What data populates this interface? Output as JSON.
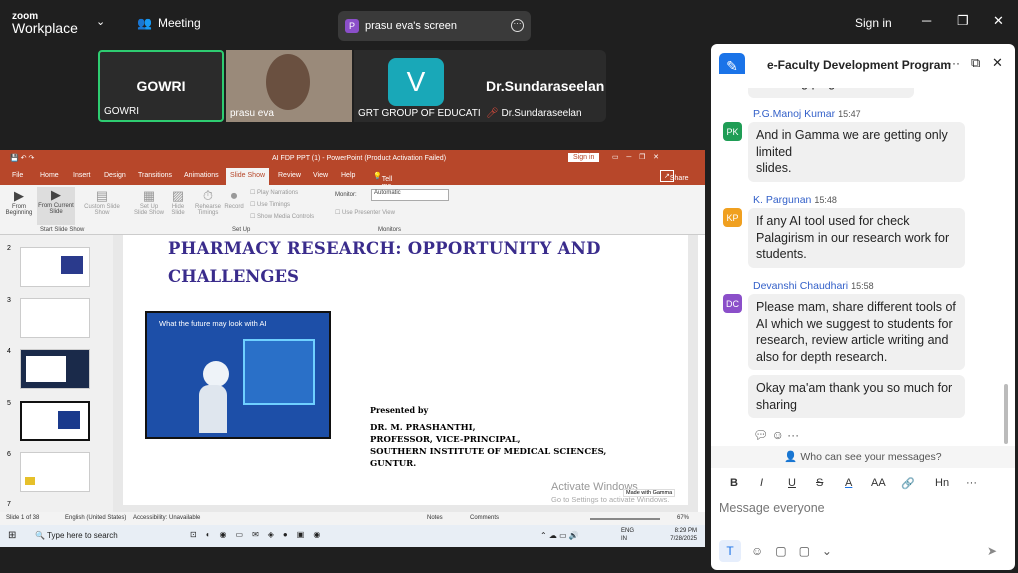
{
  "zoom": {
    "logo_top": "zoom",
    "logo_bottom": "Workplace",
    "meeting": "Meeting",
    "share_tag": "P",
    "share_label": "prasu eva's screen",
    "signin": "Sign in"
  },
  "tiles": [
    {
      "name": "GOWRI",
      "label": "GOWRI"
    },
    {
      "label": "prasu eva"
    },
    {
      "letter": "V",
      "label": "GRT GROUP OF EDUCATI..."
    },
    {
      "name": "Dr.Sundaraseelan",
      "label": "Dr.Sundaraseelan"
    }
  ],
  "ppt": {
    "title": "AI FDP PPT (1) - PowerPoint (Product Activation Failed)",
    "signin": "Sign in",
    "share": "Share",
    "menu": [
      "File",
      "Home",
      "Insert",
      "Design",
      "Transitions",
      "Animations",
      "Slide Show",
      "Review",
      "View",
      "Help",
      "Tell me what you want to do"
    ],
    "ribbon": {
      "from_beginning": "From Beginning",
      "from_current": "From Current Slide",
      "custom": "Custom Slide Show",
      "group_start": "Start Slide Show",
      "setup": "Set Up Slide Show",
      "hide": "Hide Slide",
      "rehearse": "Rehearse Timings",
      "record": "Record",
      "play": "Play Narrations",
      "timings": "Use Timings",
      "media": "Show Media Controls",
      "group_setup": "Set Up",
      "monitor": "Monitor:",
      "monitor_val": "Automatic",
      "presenter": "Use Presenter View",
      "group_monitors": "Monitors"
    },
    "thumb_nums": [
      "2",
      "3",
      "4",
      "5",
      "6",
      "7"
    ],
    "slide": {
      "title_line1": "PHARMACY RESEARCH: OPPORTUNITY AND",
      "title_line2": "CHALLENGES",
      "image_caption": "What the future may look with AI",
      "presented_by": "Presented by",
      "p1": "DR. M. PRASHANTHI,",
      "p2": "PROFESSOR, VICE-PRINCIPAL,",
      "p3": "SOUTHERN INSTITUTE OF MEDICAL SCIENCES,",
      "p4": "GUNTUR.",
      "activate": "Activate Windows",
      "activate_sub": "Go to Settings to activate Windows.",
      "gamma": "Made with Gamma"
    },
    "status": {
      "slide": "Slide 1 of 38",
      "lang": "English (United States)",
      "access": "Accessibility: Unavailable",
      "notes": "Notes",
      "comments": "Comments",
      "zoom": "67%"
    }
  },
  "taskbar": {
    "search": "Type here to search",
    "lang": "ENG",
    "region": "IN",
    "time": "8:29 PM",
    "date": "7/28/2025"
  },
  "chat": {
    "title": "e-Faculty Development Program",
    "truncated": "Checking plagiarism ai tool",
    "messages": [
      {
        "initials": "PK",
        "color": "#1f9d55",
        "name": "P.G.Manoj Kumar",
        "time": "15:47",
        "text": "And in Gamma we are getting only limited\n slides."
      },
      {
        "initials": "KP",
        "color": "#f0a020",
        "name": "K. Pargunan",
        "time": "15:48",
        "text": "If any AI tool used for check Palagirism in our research work for students."
      },
      {
        "initials": "DC",
        "color": "#8b4fc9",
        "name": "Devanshi Chaudhari",
        "time": "15:58",
        "text": "Please mam, share different tools of AI which we  suggest to students for research, review article writing and also for depth research."
      }
    ],
    "followup": "Okay ma'am thank you so much for sharing",
    "privacy": "Who can see your messages?",
    "placeholder": "Message everyone",
    "fmt": [
      "B",
      "I",
      "U",
      "S",
      "A",
      "AA",
      "🔗",
      "Hn",
      "···"
    ]
  }
}
